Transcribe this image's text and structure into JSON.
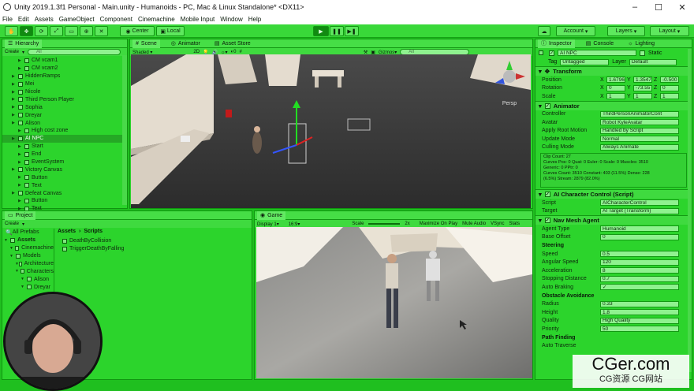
{
  "window": {
    "title": "Unity 2019.1.3f1 Personal - Main.unity - Humanoids - PC, Mac & Linux Standalone* <DX11>",
    "min_glyph": "–",
    "max_glyph": "☐",
    "close_glyph": "✕"
  },
  "menu": [
    "File",
    "Edit",
    "Assets",
    "GameObject",
    "Component",
    "Cinemachine",
    "Mobile Input",
    "Window",
    "Help"
  ],
  "toolbar": {
    "center_label": "Center",
    "local_label": "Local",
    "account_label": "Account",
    "layers_label": "Layers",
    "layout_label": "Layout"
  },
  "hierarchy": {
    "tab_label": "Hierarchy",
    "create_label": "Create",
    "search_placeholder": "All",
    "items": [
      {
        "label": "CM vcam1",
        "indent": 2,
        "sel": false
      },
      {
        "label": "CM vcam2",
        "indent": 2,
        "sel": false
      },
      {
        "label": "HiddenRamps",
        "indent": 1,
        "sel": false
      },
      {
        "label": "Mei",
        "indent": 1,
        "sel": false
      },
      {
        "label": "Nicole",
        "indent": 1,
        "sel": false
      },
      {
        "label": "Third Person Player",
        "indent": 1,
        "sel": false
      },
      {
        "label": "Sophia",
        "indent": 1,
        "sel": false
      },
      {
        "label": "Dreyar",
        "indent": 1,
        "sel": false
      },
      {
        "label": "Alison",
        "indent": 1,
        "sel": false
      },
      {
        "label": "High cost zone",
        "indent": 2,
        "sel": false
      },
      {
        "label": "AI NPC",
        "indent": 1,
        "sel": true
      },
      {
        "label": "Start",
        "indent": 2,
        "sel": false
      },
      {
        "label": "End",
        "indent": 2,
        "sel": false
      },
      {
        "label": "EventSystem",
        "indent": 2,
        "sel": false
      },
      {
        "label": "Victory Canvas",
        "indent": 1,
        "sel": false
      },
      {
        "label": "Button",
        "indent": 2,
        "sel": false
      },
      {
        "label": "Text",
        "indent": 2,
        "sel": false
      },
      {
        "label": "Defeat Canvas",
        "indent": 1,
        "sel": false
      },
      {
        "label": "Button",
        "indent": 2,
        "sel": false
      },
      {
        "label": "Text",
        "indent": 2,
        "sel": false
      }
    ]
  },
  "scene": {
    "tabs": [
      "Scene",
      "Animator",
      "Asset Store"
    ],
    "shading": "Shaded",
    "mode_2d": "2D",
    "gizmos_label": "Gizmos",
    "search_placeholder": "All",
    "persp_label": "Persp"
  },
  "project": {
    "tab_label": "Project",
    "create_label": "Create",
    "favorites_label": "All Prefabs",
    "tree": [
      {
        "label": "Assets",
        "indent": 0
      },
      {
        "label": "Cinemachine",
        "indent": 1
      },
      {
        "label": "Models",
        "indent": 1
      },
      {
        "label": "Architecture",
        "indent": 2
      },
      {
        "label": "Characters",
        "indent": 2
      },
      {
        "label": "Alison",
        "indent": 3
      },
      {
        "label": "Dreyar",
        "indent": 3
      }
    ],
    "breadcrumb_root": "Assets",
    "breadcrumb_leaf": "Scripts",
    "files": [
      "DeathByCollision",
      "TriggerDeathByFalling"
    ]
  },
  "game": {
    "tab_label": "Game",
    "display": "Display 1",
    "aspect": "16:9",
    "scale_label": "Scale",
    "scale_value": "2x",
    "maximize": "Maximize On Play",
    "mute": "Mute Audio",
    "vsync": "VSync",
    "stats": "Stats"
  },
  "inspector": {
    "tabs": [
      "Inspector",
      "Console",
      "Lighting"
    ],
    "object_name": "AI NPC",
    "static_label": "Static",
    "tag_label": "Tag",
    "tag_value": "Untagged",
    "layer_label": "Layer",
    "layer_value": "Default",
    "transform": {
      "title": "Transform",
      "rows": [
        {
          "label": "Position",
          "x": "1.6796",
          "y": "1.3547",
          "z": "-0.500"
        },
        {
          "label": "Rotation",
          "x": "0",
          "y": "-73.55",
          "z": "0"
        },
        {
          "label": "Scale",
          "x": "1",
          "y": "1",
          "z": "1"
        }
      ]
    },
    "animator": {
      "title": "Animator",
      "rows": [
        {
          "label": "Controller",
          "value": "ThirdPersonAnimatorCont"
        },
        {
          "label": "Avatar",
          "value": "Robot KyleAvatar"
        },
        {
          "label": "Apply Root Motion",
          "value": "Handled by Script"
        },
        {
          "label": "Update Mode",
          "value": "Normal"
        },
        {
          "label": "Culling Mode",
          "value": "Always Animate"
        }
      ],
      "info": "Clip Count: 27\nCurves Pos: 0 Quat: 0 Euler: 0 Scale: 0 Muscles: 3510\nGeneric: 0 PPtr: 0\nCurves Count: 3510 Constant: 403 (11.5%) Dense: 228\n(6.5%) Stream: 2879 (82.0%)"
    },
    "ai_control": {
      "title": "AI Character Control (Script)",
      "rows": [
        {
          "label": "Script",
          "value": "AICharacterControl"
        },
        {
          "label": "Target",
          "value": "AI Target (Transform)"
        }
      ]
    },
    "nav_agent": {
      "title": "Nav Mesh Agent",
      "rows": [
        {
          "label": "Agent Type",
          "value": "Humanoid"
        },
        {
          "label": "Base Offset",
          "value": "0"
        }
      ],
      "steering_title": "Steering",
      "steering": [
        {
          "label": "Speed",
          "value": "0.5"
        },
        {
          "label": "Angular Speed",
          "value": "120"
        },
        {
          "label": "Acceleration",
          "value": "8"
        },
        {
          "label": "Stopping Distance",
          "value": "0.7"
        },
        {
          "label": "Auto Braking",
          "value": "✓"
        }
      ],
      "avoidance_title": "Obstacle Avoidance",
      "avoidance": [
        {
          "label": "Radius",
          "value": "0.33"
        },
        {
          "label": "Height",
          "value": "1.8"
        },
        {
          "label": "Quality",
          "value": "High Quality"
        },
        {
          "label": "Priority",
          "value": "50"
        }
      ],
      "pathfinding_title": "Path Finding",
      "auto_traverse": "Auto Traverse"
    }
  },
  "watermark": {
    "main": "CGer.com",
    "sub": "CG资源 CG网站"
  },
  "colors": {
    "chroma_green": "#1fbf1f",
    "selection": "#25a825",
    "scene_bg": "#3b3b3b"
  }
}
